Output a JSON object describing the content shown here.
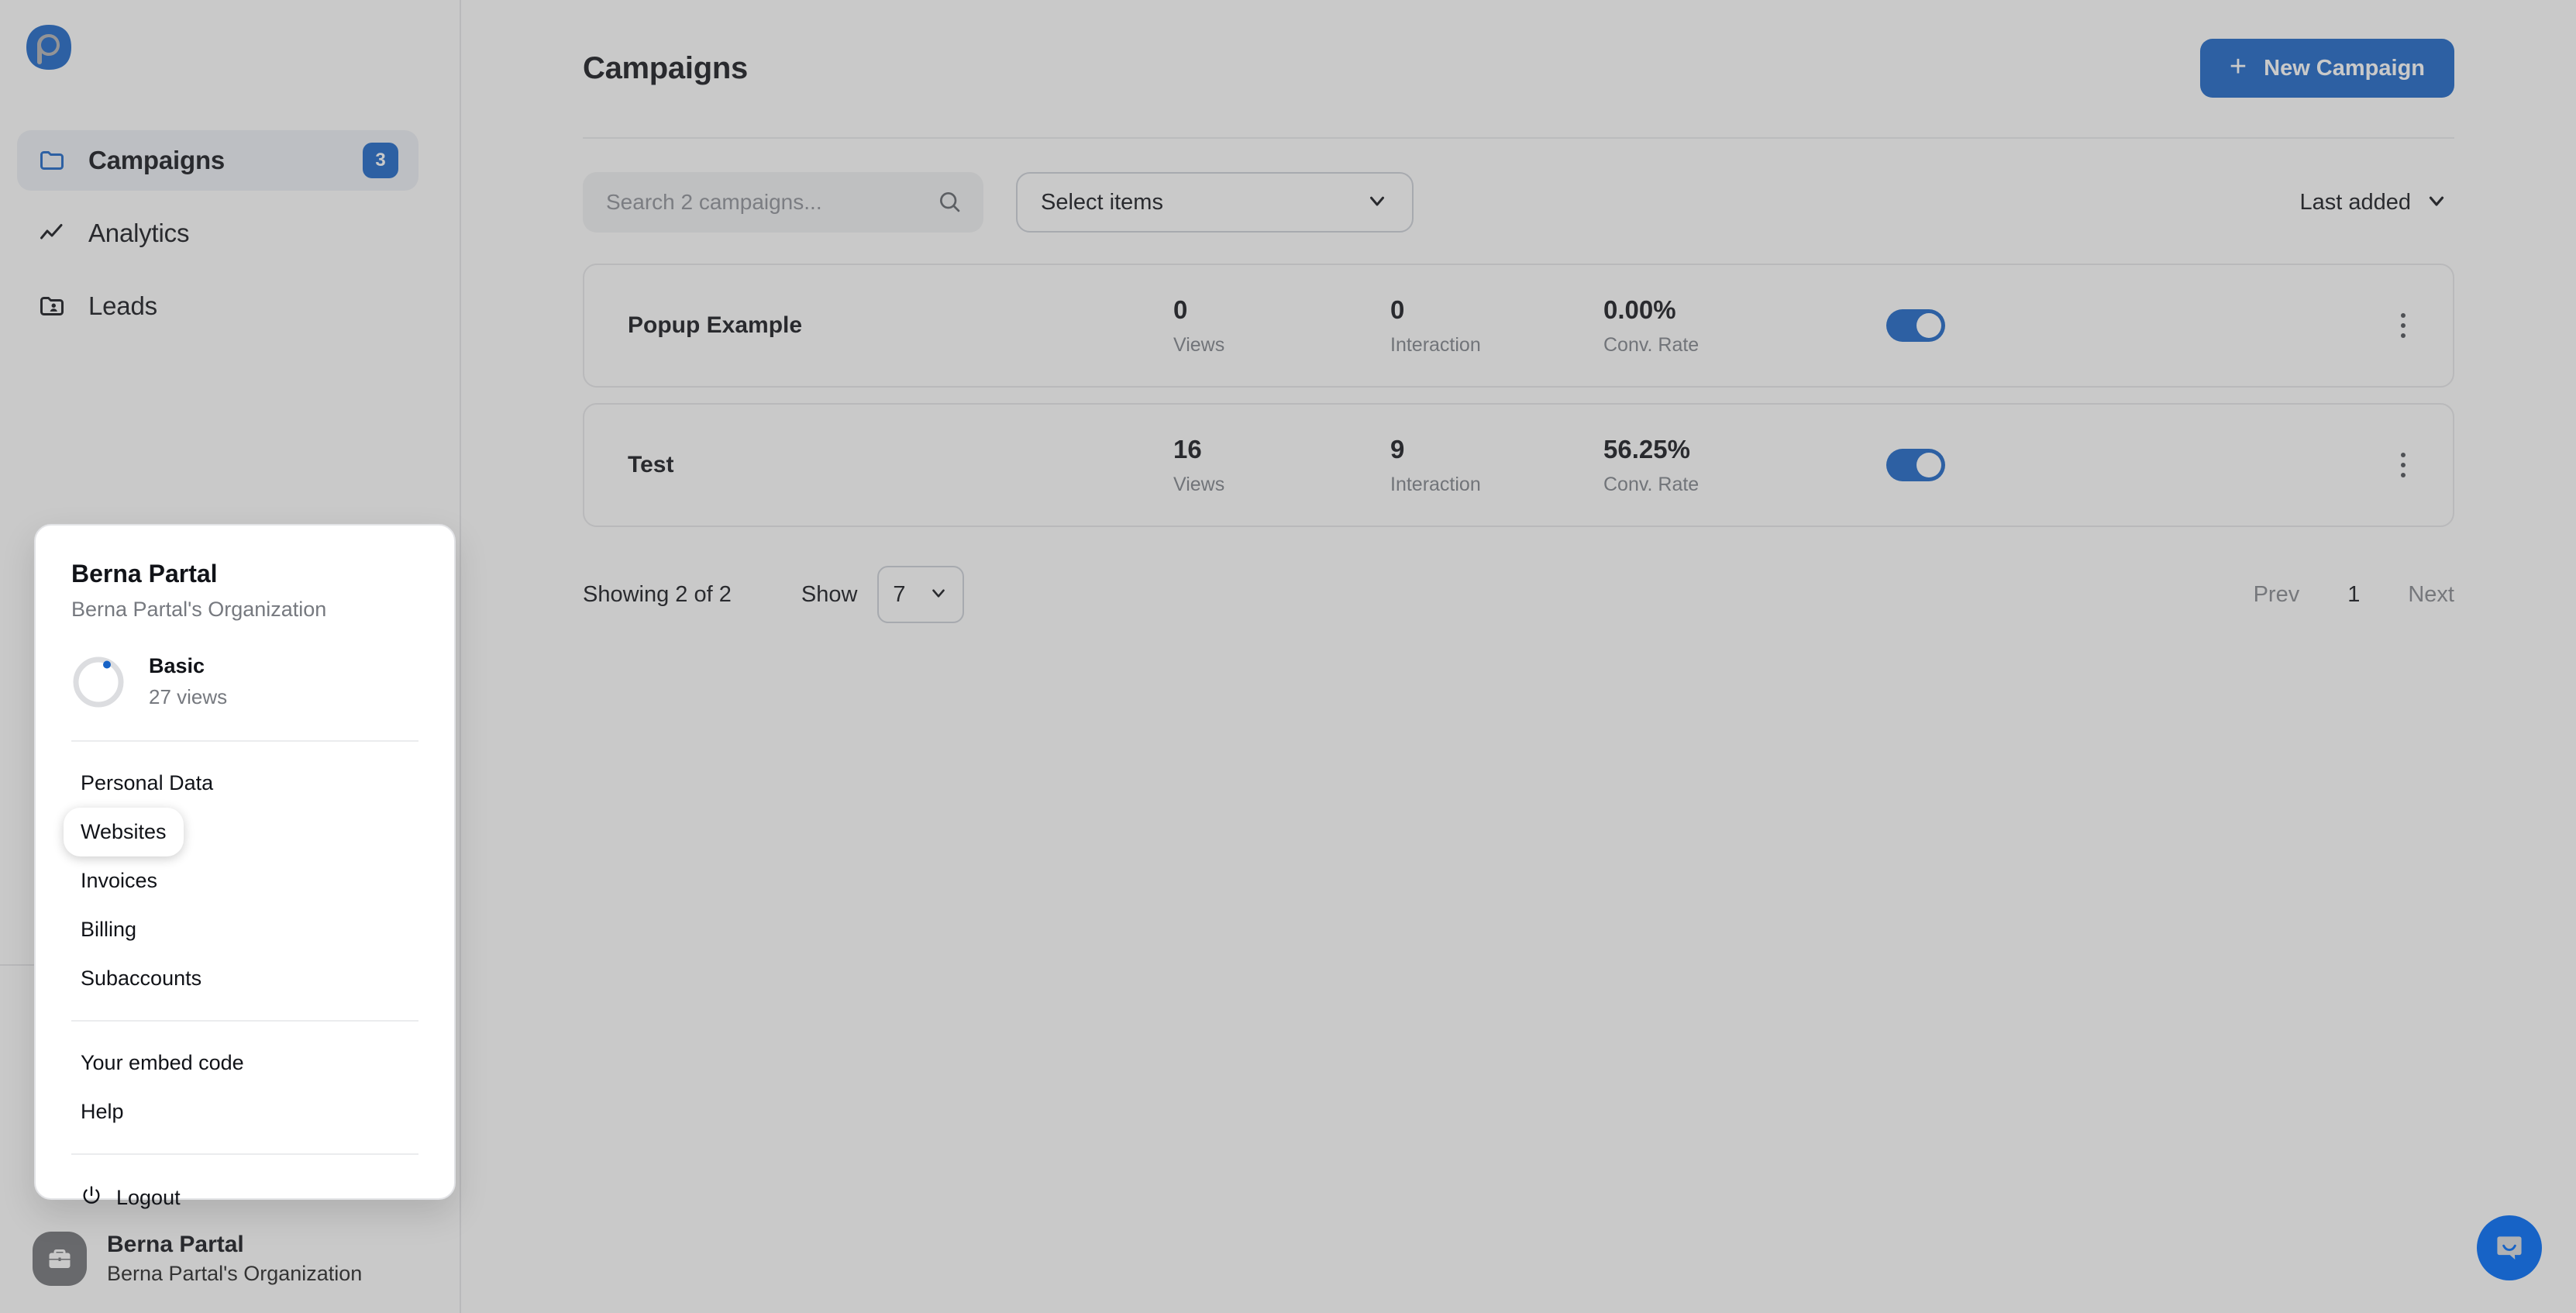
{
  "app": {
    "logo_icon": "popupsmart-logo-icon",
    "accent_color": "#1763c6",
    "overlay_active": true
  },
  "sidebar": {
    "items": [
      {
        "label": "Campaigns",
        "icon": "folder-icon",
        "badge": "3",
        "active": true
      },
      {
        "label": "Analytics",
        "icon": "line-chart-icon",
        "badge": "",
        "active": false
      },
      {
        "label": "Leads",
        "icon": "folder-user-icon",
        "badge": "",
        "active": false
      }
    ],
    "account": {
      "name": "Berna Partal",
      "organization": "Berna Partal's Organization",
      "avatar_icon": "briefcase-icon"
    }
  },
  "user_menu": {
    "name": "Berna Partal",
    "organization": "Berna Partal's Organization",
    "plan": {
      "name": "Basic",
      "usage": "27 views",
      "ring_icon": "progress-ring-icon"
    },
    "group_one": [
      {
        "label": "Personal Data",
        "highlighted": false
      },
      {
        "label": "Websites",
        "highlighted": true
      },
      {
        "label": "Invoices",
        "highlighted": false
      },
      {
        "label": "Billing",
        "highlighted": false
      },
      {
        "label": "Subaccounts",
        "highlighted": false
      }
    ],
    "group_two": [
      {
        "label": "Your embed code"
      },
      {
        "label": "Help"
      }
    ],
    "logout": {
      "label": "Logout",
      "icon": "power-icon"
    }
  },
  "header": {
    "title": "Campaigns",
    "new_campaign_label": "New Campaign",
    "new_campaign_icon": "plus-icon"
  },
  "toolbar": {
    "search_placeholder": "Search 2 campaigns...",
    "search_value": "",
    "search_icon": "search-icon",
    "select_items_label": "Select items",
    "select_items_icon": "chevron-down-icon",
    "sort_label": "Last added",
    "sort_icon": "chevron-down-icon"
  },
  "campaigns": {
    "metric_labels": {
      "views": "Views",
      "interaction": "Interaction",
      "conversion": "Conv. Rate"
    },
    "rows": [
      {
        "name": "Popup Example",
        "views": "0",
        "interaction": "0",
        "conversion": "0.00%",
        "enabled": true,
        "menu_icon": "kebab-menu-icon"
      },
      {
        "name": "Test",
        "views": "16",
        "interaction": "9",
        "conversion": "56.25%",
        "enabled": true,
        "menu_icon": "kebab-menu-icon"
      }
    ]
  },
  "footer": {
    "showing": "Showing 2 of 2",
    "show_label": "Show",
    "show_value": "7",
    "show_icon": "chevron-down-icon",
    "prev_label": "Prev",
    "page_label": "1",
    "next_label": "Next"
  },
  "chat": {
    "icon": "chat-bubble-icon"
  }
}
